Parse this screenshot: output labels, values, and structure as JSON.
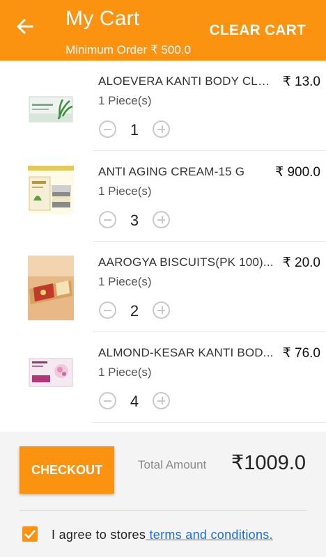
{
  "header": {
    "title": "My Cart",
    "subtitle": "Minimum Order ₹ 500.0",
    "clear_label": "CLEAR CART"
  },
  "items": [
    {
      "name": "ALOEVERA KANTI BODY CLE...",
      "price": "₹ 13.0",
      "unit": "1 Piece(s)",
      "qty": "1"
    },
    {
      "name": "ANTI AGING CREAM-15 G",
      "price": "₹ 900.0",
      "unit": "1 Piece(s)",
      "qty": "3"
    },
    {
      "name": "AAROGYA BISCUITS(PK 100)...",
      "price": "₹ 20.0",
      "unit": "1 Piece(s)",
      "qty": "2"
    },
    {
      "name": "ALMOND-KESAR KANTI BOD...",
      "price": "₹ 76.0",
      "unit": "1 Piece(s)",
      "qty": "4"
    }
  ],
  "footer": {
    "checkout_label": "CHECKOUT",
    "total_label": "Total Amount",
    "total_value": "₹1009.0",
    "agree_text": "I agree to stores",
    "terms_link": " terms and conditions.",
    "agree_checked": true
  },
  "colors": {
    "accent": "#fb9310",
    "link": "#1e6dd6"
  }
}
